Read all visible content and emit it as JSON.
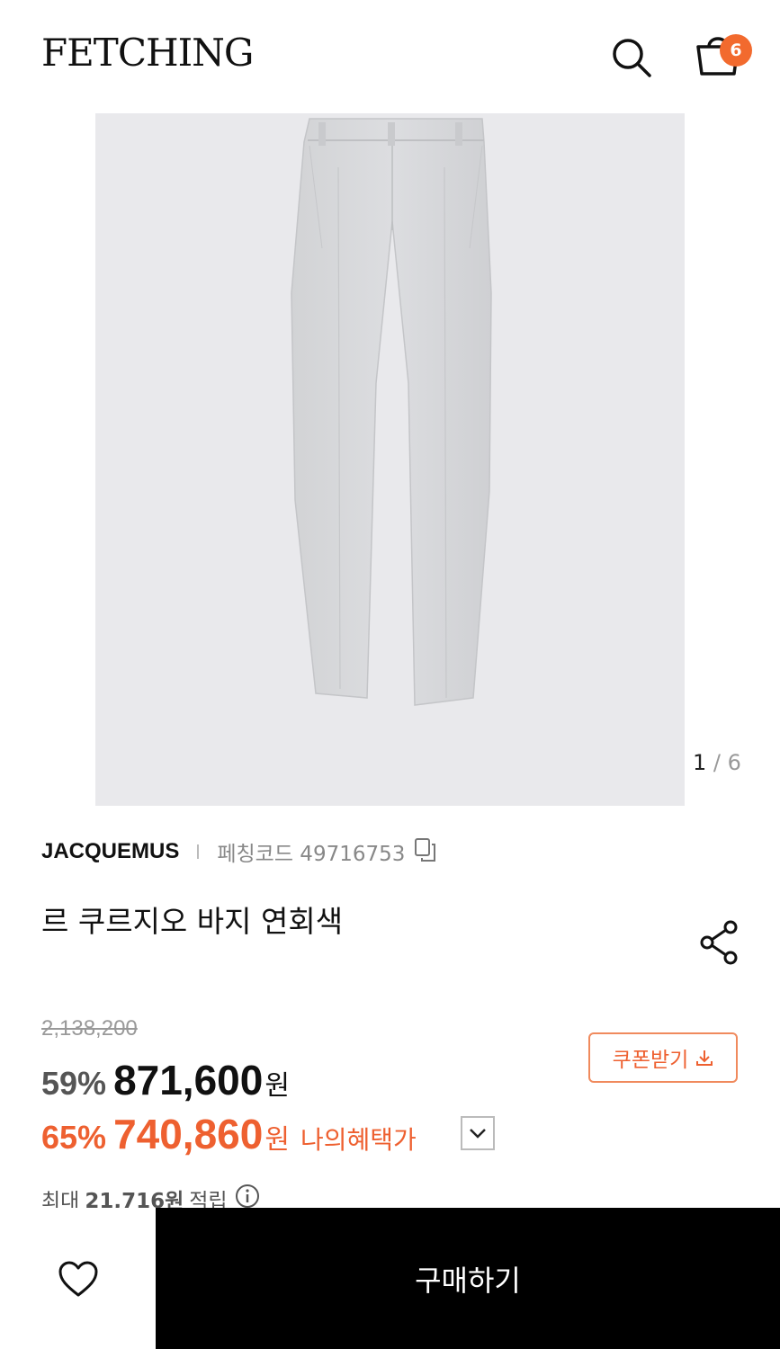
{
  "header": {
    "logo": "FETCHING",
    "cart_count": "6"
  },
  "gallery": {
    "current": "1",
    "separator": "/",
    "total": "6",
    "image_alt": "pants-photo"
  },
  "product": {
    "brand": "JACQUEMUS",
    "code_label": "페칭코드 49716753",
    "title": "르 쿠르지오 바지 연회색"
  },
  "pricing": {
    "original": "2,138,200",
    "sale_percent": "59%",
    "sale_amount": "871,600",
    "currency": "원",
    "benefit_percent": "65%",
    "benefit_amount": "740,860",
    "benefit_label": "나의혜택가"
  },
  "coupon": {
    "label": "쿠폰받기"
  },
  "points": {
    "prefix": "최대",
    "amount": "21,716원",
    "suffix": "적립"
  },
  "bottom": {
    "buy_label": "구매하기"
  },
  "colors": {
    "accent": "#ee6030",
    "badge": "#f26a2e",
    "buy_bg": "#000000",
    "gallery_bg": "#e9e9ec"
  },
  "icons": [
    "search-icon",
    "cart-icon",
    "copy-icon",
    "share-icon",
    "chevron-down-icon",
    "download-icon",
    "info-icon",
    "heart-icon"
  ]
}
